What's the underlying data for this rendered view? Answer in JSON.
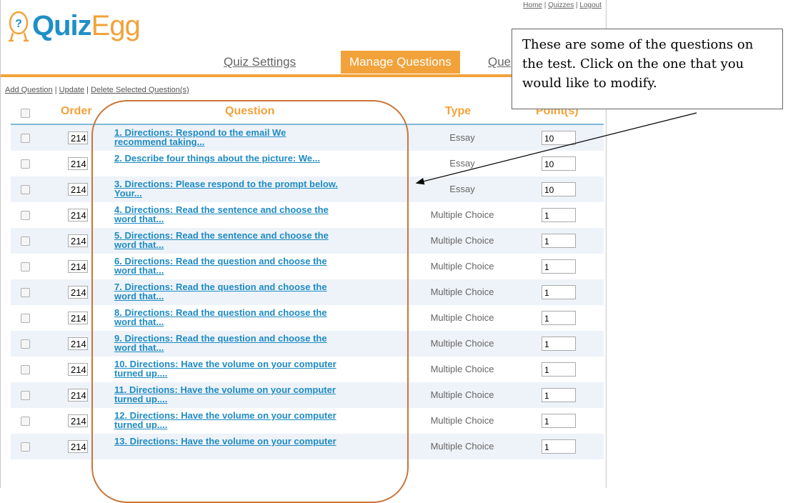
{
  "top_links": {
    "home": "Home",
    "quizzes": "Quizzes",
    "logout": "Logout",
    "sep": " | "
  },
  "logo": {
    "quiz": "Quiz",
    "egg": "Egg"
  },
  "tabs": [
    {
      "label": "Quiz Settings",
      "active": false
    },
    {
      "label": "Manage Questions",
      "active": true
    },
    {
      "label": "Que",
      "active": false
    }
  ],
  "actions": {
    "add": "Add Question",
    "update": "Update",
    "delete": "Delete Selected Question(s)",
    "sep": " | "
  },
  "table": {
    "headers": {
      "order": "Order",
      "question": "Question",
      "type": "Type",
      "points": "Point(s)"
    },
    "rows": [
      {
        "order": "214",
        "line1": "1. Directions: Respond to the email We",
        "line2": "recommend taking...",
        "type": "Essay",
        "points": "10"
      },
      {
        "order": "214",
        "line1": "2. Describe four things about the picture: We...",
        "line2": "",
        "type": "Essay",
        "points": "10"
      },
      {
        "order": "214",
        "line1": "3. Directions: Please respond to the prompt below.",
        "line2": "Your...",
        "type": "Essay",
        "points": "10"
      },
      {
        "order": "214",
        "line1": "4. Directions: Read the sentence and choose the",
        "line2": "word that...",
        "type": "Multiple Choice",
        "points": "1"
      },
      {
        "order": "214",
        "line1": "5. Directions: Read the sentence and choose the",
        "line2": "word that...",
        "type": "Multiple Choice",
        "points": "1"
      },
      {
        "order": "214",
        "line1": "6. Directions: Read the question and choose the",
        "line2": "word that...",
        "type": "Multiple Choice",
        "points": "1"
      },
      {
        "order": "214",
        "line1": "7. Directions: Read the question and choose the",
        "line2": "word that...",
        "type": "Multiple Choice",
        "points": "1"
      },
      {
        "order": "214",
        "line1": "8. Directions: Read the question and choose the",
        "line2": "word that...",
        "type": "Multiple Choice",
        "points": "1"
      },
      {
        "order": "214",
        "line1": "9. Directions: Read the question and choose the",
        "line2": "word that...",
        "type": "Multiple Choice",
        "points": "1"
      },
      {
        "order": "214",
        "line1": "10. Directions: Have the volume on your computer",
        "line2": "turned up....",
        "type": "Multiple Choice",
        "points": "1"
      },
      {
        "order": "214",
        "line1": "11. Directions: Have the volume on your computer",
        "line2": "turned up....",
        "type": "Multiple Choice",
        "points": "1"
      },
      {
        "order": "214",
        "line1": "12. Directions: Have the volume on your computer",
        "line2": "turned up....",
        "type": "Multiple Choice",
        "points": "1"
      },
      {
        "order": "214",
        "line1": "13. Directions: Have the volume on your computer",
        "line2": "",
        "type": "Multiple Choice",
        "points": "1"
      }
    ]
  },
  "callout": {
    "text": "These are some of the questions on the test. Click on the one that you would like to modify."
  },
  "colors": {
    "accent": "#f2a23a",
    "link": "#1e8bc3",
    "header_rule": "#7db8d8",
    "annotation": "#c8763a"
  }
}
